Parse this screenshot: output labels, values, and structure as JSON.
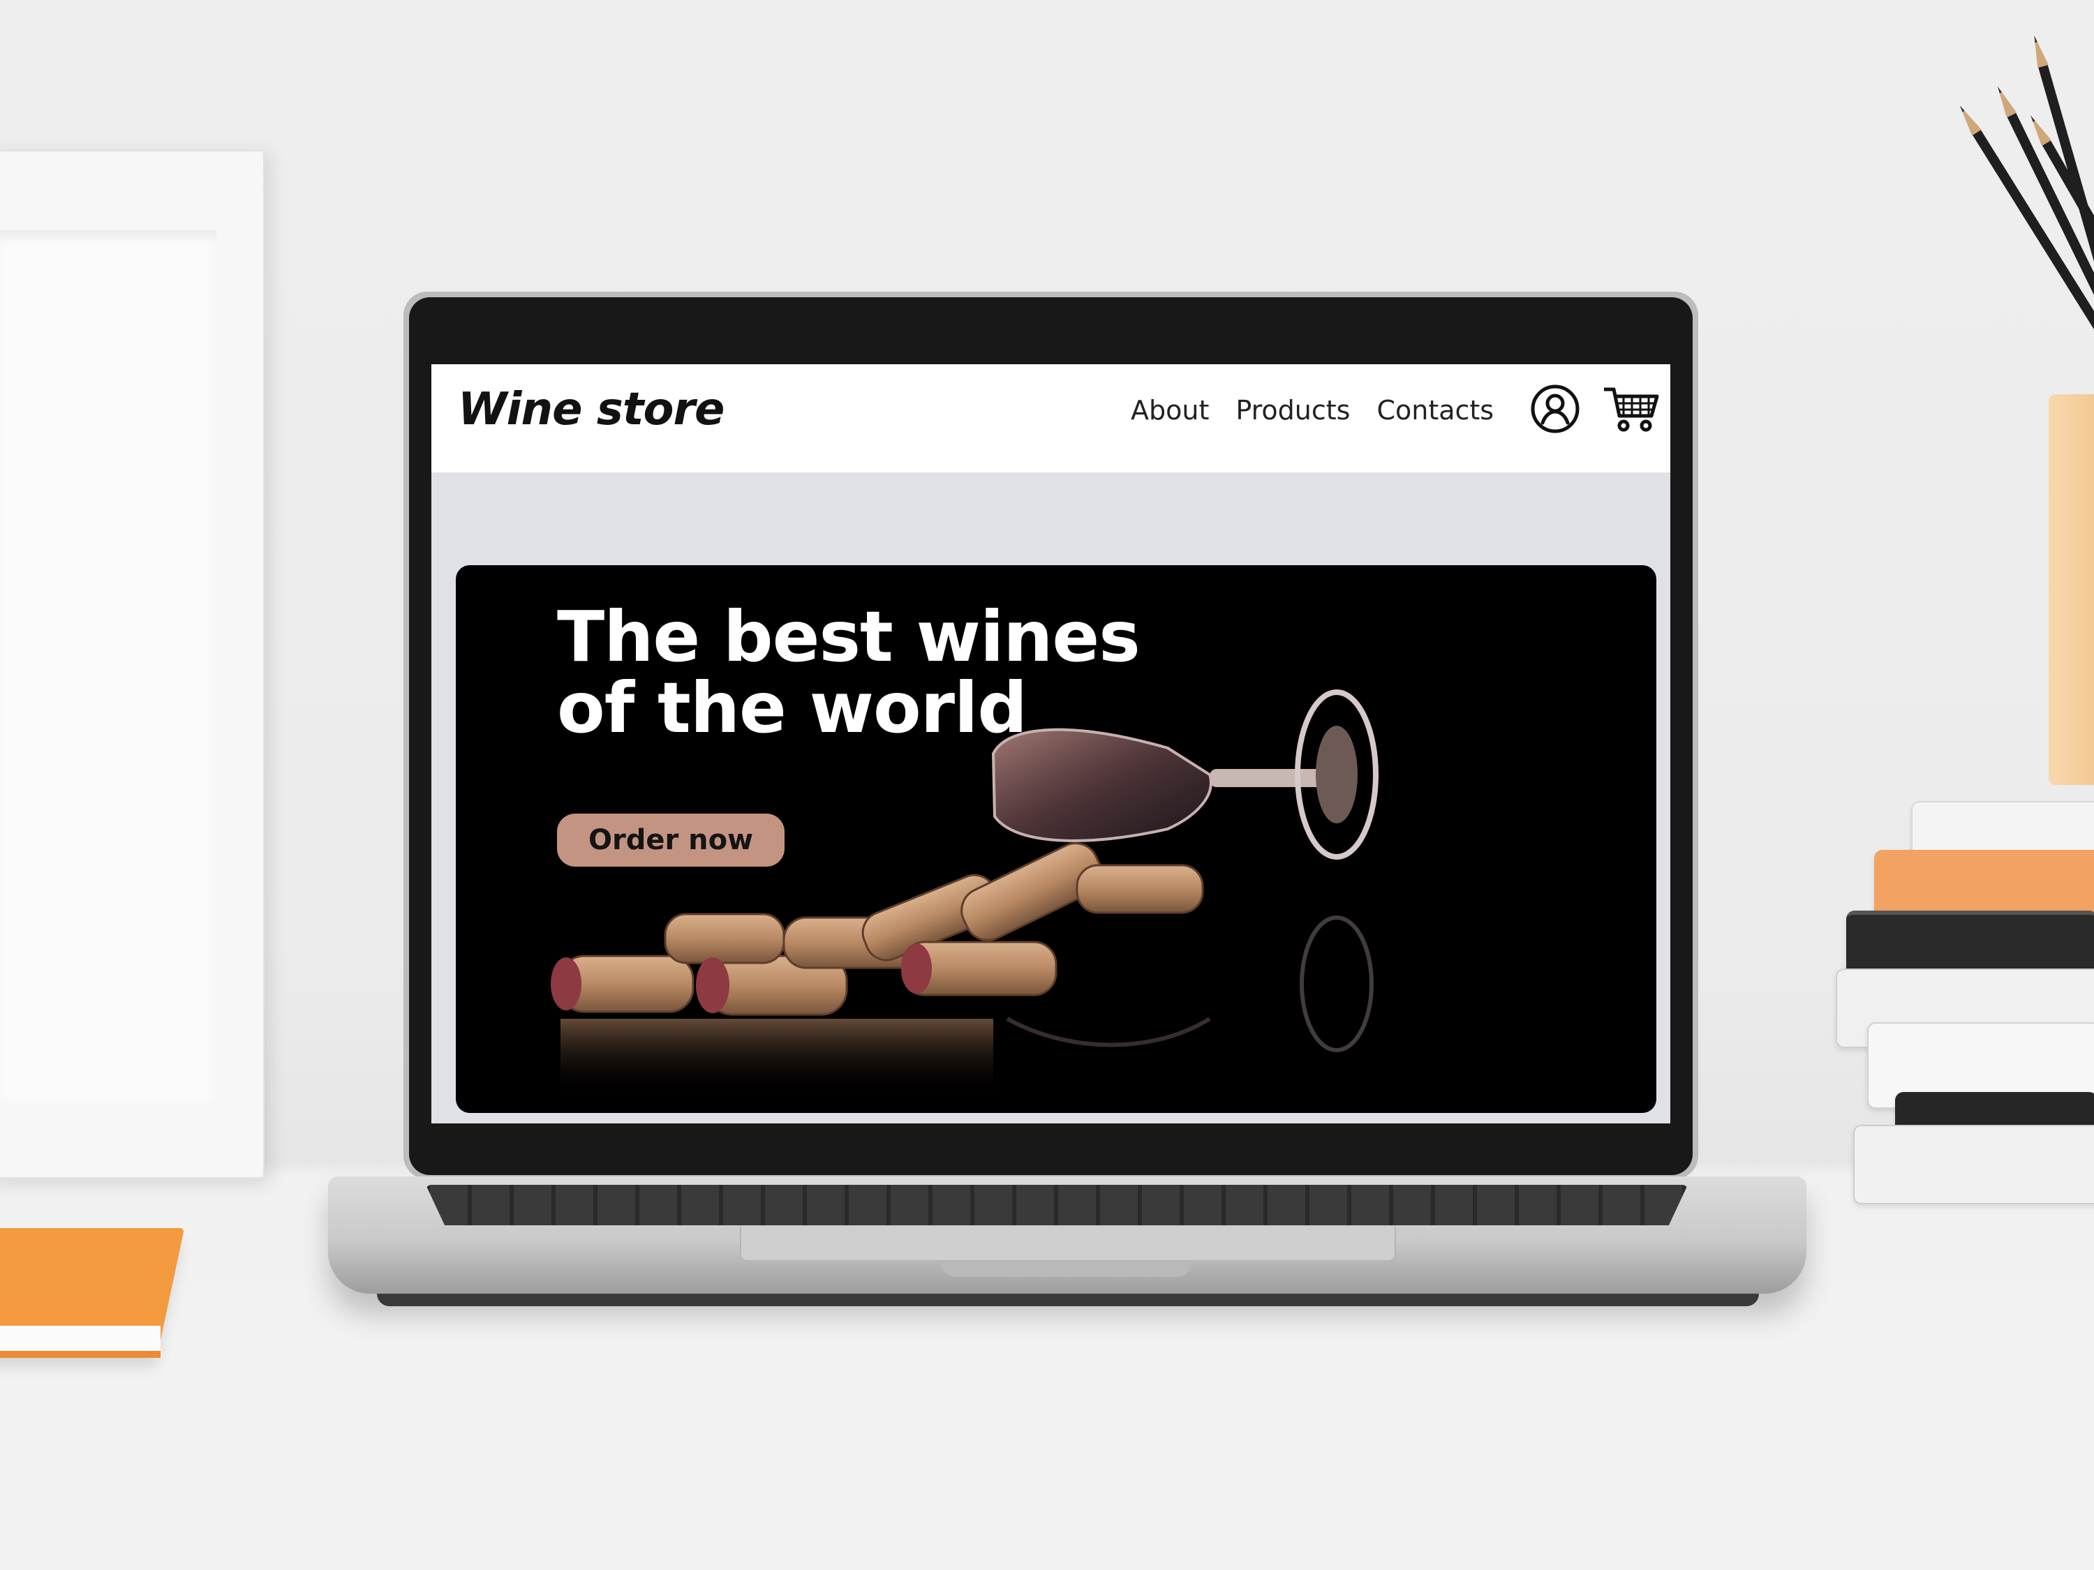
{
  "site": {
    "logo": "Wine store",
    "nav": {
      "about": "About",
      "products": "Products",
      "contacts": "Contacts"
    },
    "hero": {
      "headline_line1": "The best wines",
      "headline_line2": "of the world",
      "cta_label": "Order now"
    }
  },
  "icons": {
    "account": "user-circle-icon",
    "cart": "shopping-cart-icon"
  },
  "colors": {
    "header_bg": "#ffffff",
    "page_bg": "#dfe1e7",
    "hero_bg": "#000000",
    "cta_bg": "#c49482"
  }
}
